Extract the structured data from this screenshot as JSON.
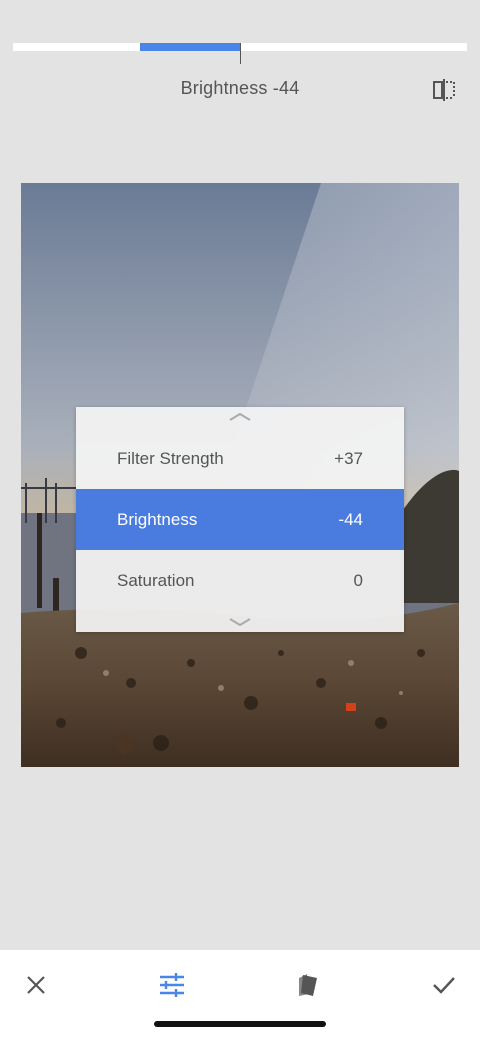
{
  "slider": {
    "value_label": "Brightness -44",
    "value": -44,
    "min": -100,
    "max": 100
  },
  "menu": {
    "items": [
      {
        "label": "Filter Strength",
        "value": "+37",
        "selected": false
      },
      {
        "label": "Brightness",
        "value": "-44",
        "selected": true
      },
      {
        "label": "Saturation",
        "value": "0",
        "selected": false
      }
    ]
  },
  "toolbar": {
    "cancel_icon": "close-icon",
    "adjust_icon": "sliders-icon",
    "styles_icon": "styles-cards-icon",
    "apply_icon": "check-icon"
  },
  "colors": {
    "accent": "#4a86e8",
    "selected_row": "#4a7ce0",
    "background": "#e3e3e3",
    "text": "#555555"
  }
}
